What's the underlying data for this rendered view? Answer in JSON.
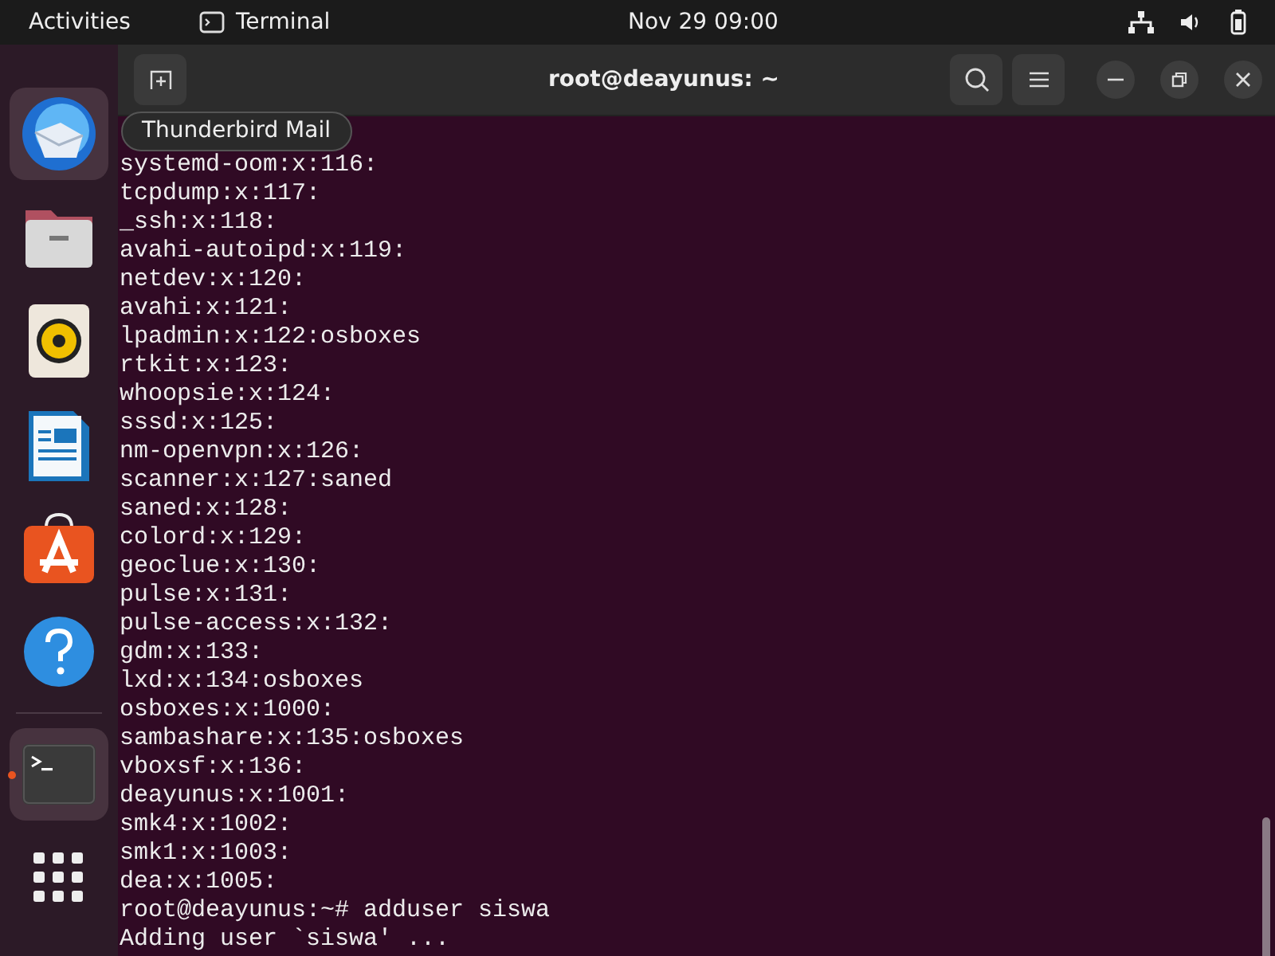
{
  "top_bar": {
    "activities": "Activities",
    "app_name": "Terminal",
    "clock": "Nov 29  09:00"
  },
  "dock": {
    "items": [
      {
        "kind": "mail",
        "hovered": true,
        "running": false,
        "tooltip": "Thunderbird Mail"
      },
      {
        "kind": "files",
        "hovered": false,
        "running": false
      },
      {
        "kind": "music",
        "hovered": false,
        "running": false
      },
      {
        "kind": "writer",
        "hovered": false,
        "running": false
      },
      {
        "kind": "store",
        "hovered": false,
        "running": false
      },
      {
        "kind": "help",
        "hovered": false,
        "running": false
      },
      {
        "kind": "terminal",
        "hovered": true,
        "running": true
      },
      {
        "kind": "apps",
        "hovered": false,
        "running": false
      }
    ]
  },
  "window": {
    "title": "root@deayunus: ~"
  },
  "terminal": {
    "lines": [
      "systemd-oom:x:116:",
      "tcpdump:x:117:",
      "_ssh:x:118:",
      "avahi-autoipd:x:119:",
      "netdev:x:120:",
      "avahi:x:121:",
      "lpadmin:x:122:osboxes",
      "rtkit:x:123:",
      "whoopsie:x:124:",
      "sssd:x:125:",
      "nm-openvpn:x:126:",
      "scanner:x:127:saned",
      "saned:x:128:",
      "colord:x:129:",
      "geoclue:x:130:",
      "pulse:x:131:",
      "pulse-access:x:132:",
      "gdm:x:133:",
      "lxd:x:134:osboxes",
      "osboxes:x:1000:",
      "sambashare:x:135:osboxes",
      "vboxsf:x:136:",
      "deayunus:x:1001:",
      "smk4:x:1002:",
      "smk1:x:1003:",
      "dea:x:1005:",
      "root@deayunus:~# adduser siswa",
      "Adding user `siswa' ..."
    ]
  }
}
